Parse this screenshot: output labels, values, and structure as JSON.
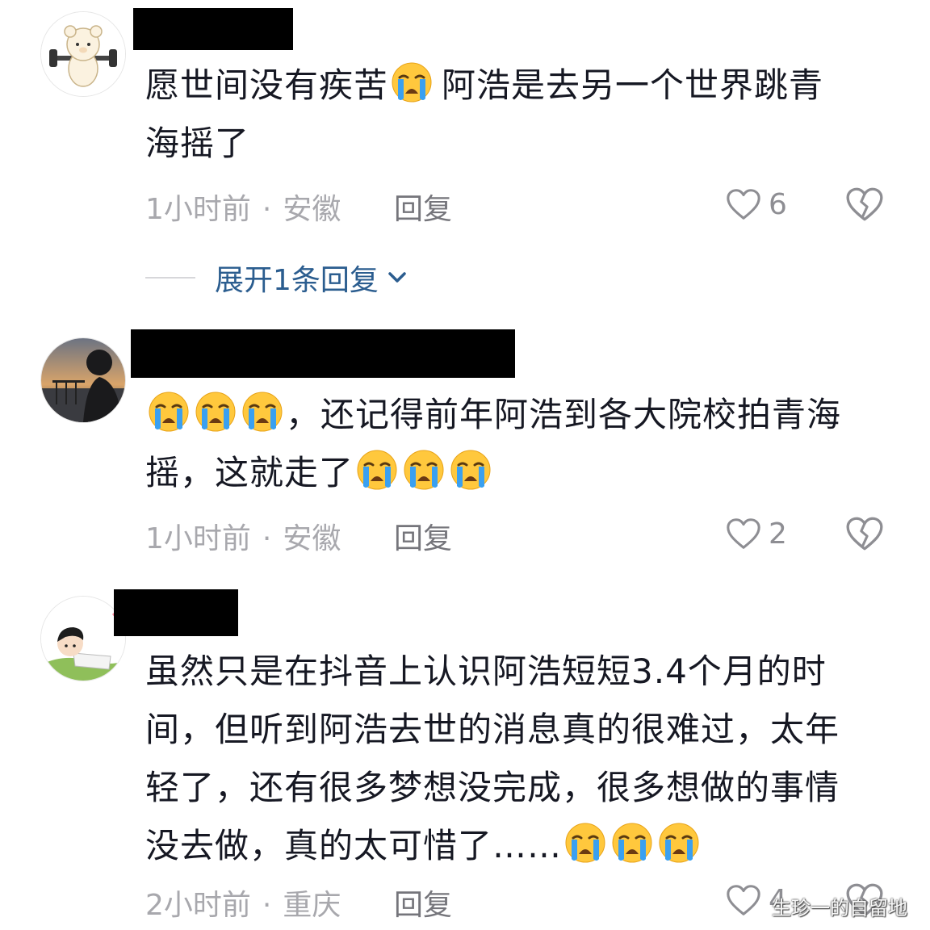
{
  "comments": [
    {
      "text": [
        "愿世间没有疾苦",
        "阿浩是去另一个世界跳青",
        "海摇了"
      ],
      "time": "1小时前",
      "location": "安徽",
      "reply_label": "回复",
      "like_count": "6",
      "expand_label": "展开1条回复"
    },
    {
      "text": [
        "，还记得前年阿浩到各大院校拍青海",
        "摇，这就走了"
      ],
      "time": "1小时前",
      "location": "安徽",
      "reply_label": "回复",
      "like_count": "2"
    },
    {
      "text": [
        "虽然只是在抖音上认识阿浩短短3.4个月的时",
        "间，但听到阿浩去世的消息真的很难过，太年",
        "轻了，还有很多梦想没完成，很多想做的事情",
        "没去做，真的太可惜了……"
      ],
      "time": "2小时前",
      "location": "重庆",
      "reply_label": "回复",
      "like_count": "4"
    }
  ],
  "separator": "·",
  "watermark": "生珍一的自留地",
  "icons": {
    "emoji": "loudly-crying-face",
    "like": "heart-outline-icon",
    "dislike": "broken-heart-icon",
    "expand": "chevron-down-icon"
  },
  "colors": {
    "link": "#2b5d8f",
    "meta": "#a8a8ad",
    "text": "#161823"
  }
}
